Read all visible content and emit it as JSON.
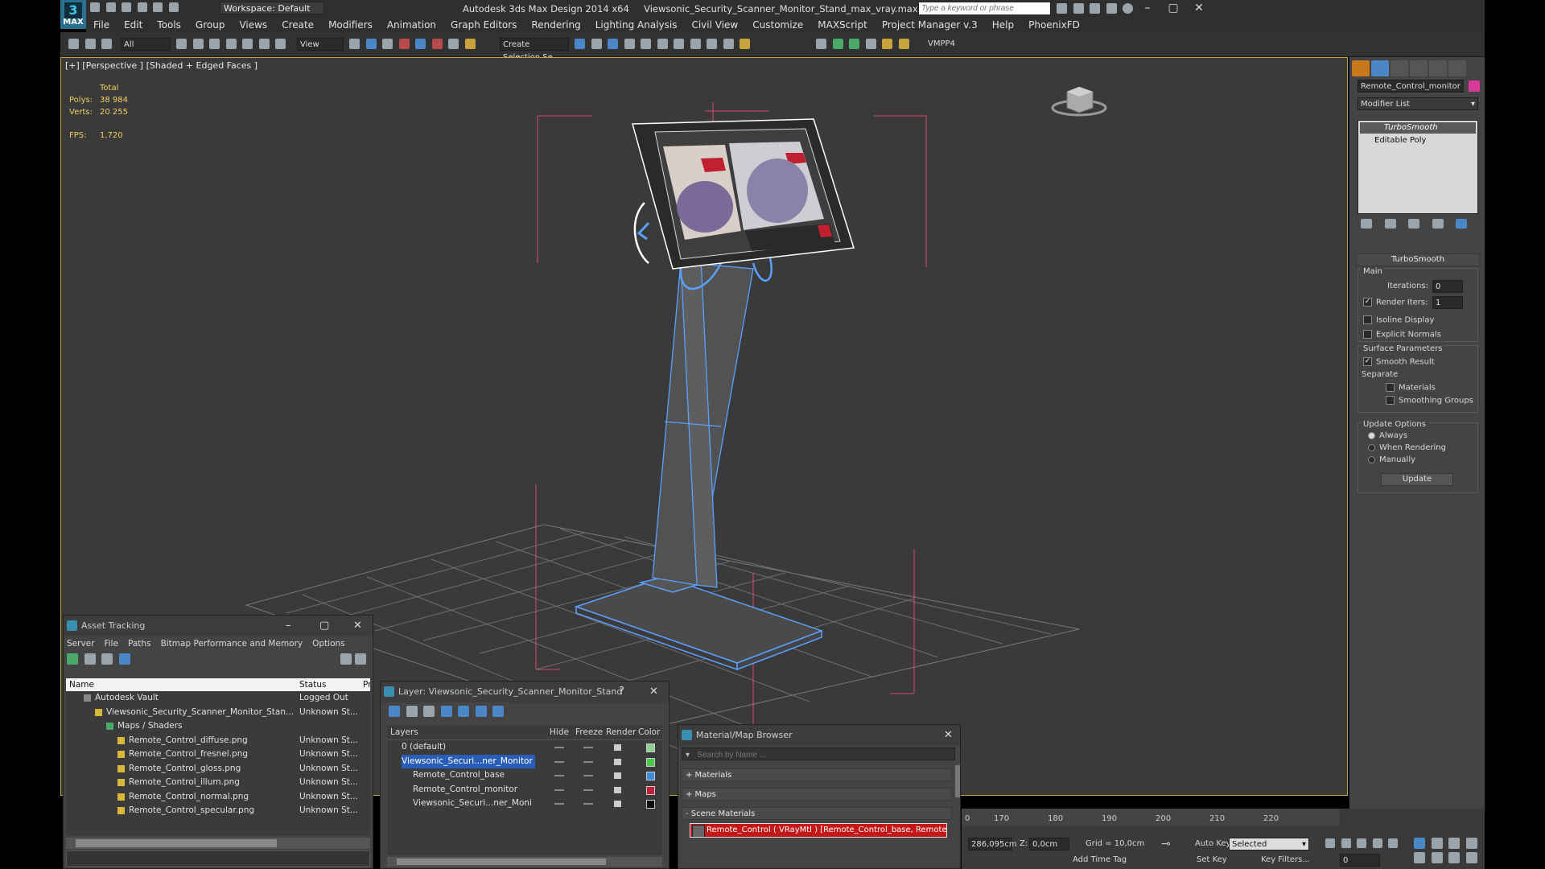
{
  "app": {
    "title": "Autodesk 3ds Max Design 2014 x64     Viewsonic_Security_Scanner_Monitor_Stand_max_vray.max",
    "workspace": "Workspace: Default",
    "search_placeholder": "Type a keyword or phrase",
    "logo": "MAX"
  },
  "menu": [
    "File",
    "Edit",
    "Tools",
    "Group",
    "Views",
    "Create",
    "Modifiers",
    "Animation",
    "Graph Editors",
    "Rendering",
    "Lighting Analysis",
    "Civil View",
    "Customize",
    "MAXScript",
    "Project Manager v.3",
    "Help",
    "PhoenixFD"
  ],
  "toolbar": {
    "filter": "All",
    "refcoord": "View",
    "selection_set": "Create Selection Se",
    "vmpp": "VMPP4"
  },
  "viewport": {
    "label": "[+] [Perspective ] [Shaded + Edged Faces ]",
    "stats": {
      "total": "Total",
      "polys_label": "Polys:",
      "polys": "38 984",
      "verts_label": "Verts:",
      "verts": "20 255",
      "fps_label": "FPS:",
      "fps": "1,720"
    }
  },
  "modify_panel": {
    "object_name": "Remote_Control_monitor",
    "modifier_list": "Modifier List",
    "stack": [
      "TurboSmooth",
      "Editable Poly"
    ],
    "rollout_title": "TurboSmooth",
    "main_label": "Main",
    "iterations_label": "Iterations:",
    "iterations": "0",
    "render_iters_label": "Render Iters:",
    "render_iters": "1",
    "isoline": "Isoline Display",
    "explicit_normals": "Explicit Normals",
    "surface_params": "Surface Parameters",
    "smooth_result": "Smooth Result",
    "separate": "Separate",
    "materials": "Materials",
    "smoothing_groups": "Smoothing Groups",
    "update_options": "Update Options",
    "always": "Always",
    "when_rendering": "When Rendering",
    "manually": "Manually",
    "update_button": "Update"
  },
  "asset_tracking": {
    "title": "Asset Tracking",
    "menu": [
      "Server",
      "File",
      "Paths",
      "Bitmap Performance and Memory",
      "Options"
    ],
    "col_name": "Name",
    "col_status": "Status",
    "col_p": "Pr",
    "rows": [
      {
        "name": "Autodesk Vault",
        "status": "Logged Out",
        "indent": 0
      },
      {
        "name": "Viewsonic_Security_Scanner_Monitor_Stan...",
        "status": "Unknown St...",
        "indent": 1
      },
      {
        "name": "Maps / Shaders",
        "status": "",
        "indent": 2
      },
      {
        "name": "Remote_Control_diffuse.png",
        "status": "Unknown St...",
        "indent": 3
      },
      {
        "name": "Remote_Control_fresnel.png",
        "status": "Unknown St...",
        "indent": 3
      },
      {
        "name": "Remote_Control_gloss.png",
        "status": "Unknown St...",
        "indent": 3
      },
      {
        "name": "Remote_Control_illum.png",
        "status": "Unknown St...",
        "indent": 3
      },
      {
        "name": "Remote_Control_normal.png",
        "status": "Unknown St...",
        "indent": 3
      },
      {
        "name": "Remote_Control_specular.png",
        "status": "Unknown St...",
        "indent": 3
      }
    ]
  },
  "layer_window": {
    "title": "Layer: Viewsonic_Security_Scanner_Monitor_Stand",
    "help": "?",
    "cols": {
      "layers": "Layers",
      "hide": "Hide",
      "freeze": "Freeze",
      "render": "Render",
      "color": "Color"
    },
    "rows": [
      {
        "name": "0 (default)",
        "color": "#8fd08f",
        "indent": 0
      },
      {
        "name": "Viewsonic_Securi...ner_Monitor",
        "color": "#4ac84a",
        "indent": 0,
        "selected": true
      },
      {
        "name": "Remote_Control_base",
        "color": "#3c8adc",
        "indent": 1
      },
      {
        "name": "Remote_Control_monitor",
        "color": "#c02040",
        "indent": 1
      },
      {
        "name": "Viewsonic_Securi...ner_Moni",
        "color": "#101010",
        "indent": 1
      }
    ]
  },
  "material_browser": {
    "title": "Material/Map Browser",
    "search_placeholder": "Search by Name ...",
    "sections": [
      "+ Materials",
      "+ Maps",
      "- Scene Materials"
    ],
    "scene_item": "Remote_Control  ( VRayMtl ) [Remote_Control_base, Remote..."
  },
  "timeline": {
    "ticks": [
      "0",
      "170",
      "180",
      "190",
      "200",
      "210",
      "220"
    ]
  },
  "status": {
    "x": "286,095cm",
    "z_label": "Z:",
    "z": "0,0cm",
    "grid": "Grid = 10,0cm",
    "auto_key": "Auto Key",
    "selected": "Selected",
    "set_key": "Set Key",
    "key_filters": "Key Filters...",
    "add_time_tag": "Add Time Tag",
    "frame": "0"
  },
  "colors": {
    "accent": "#c8a23a",
    "wire": "#5aa0ff",
    "selection": "#2a5db8"
  }
}
